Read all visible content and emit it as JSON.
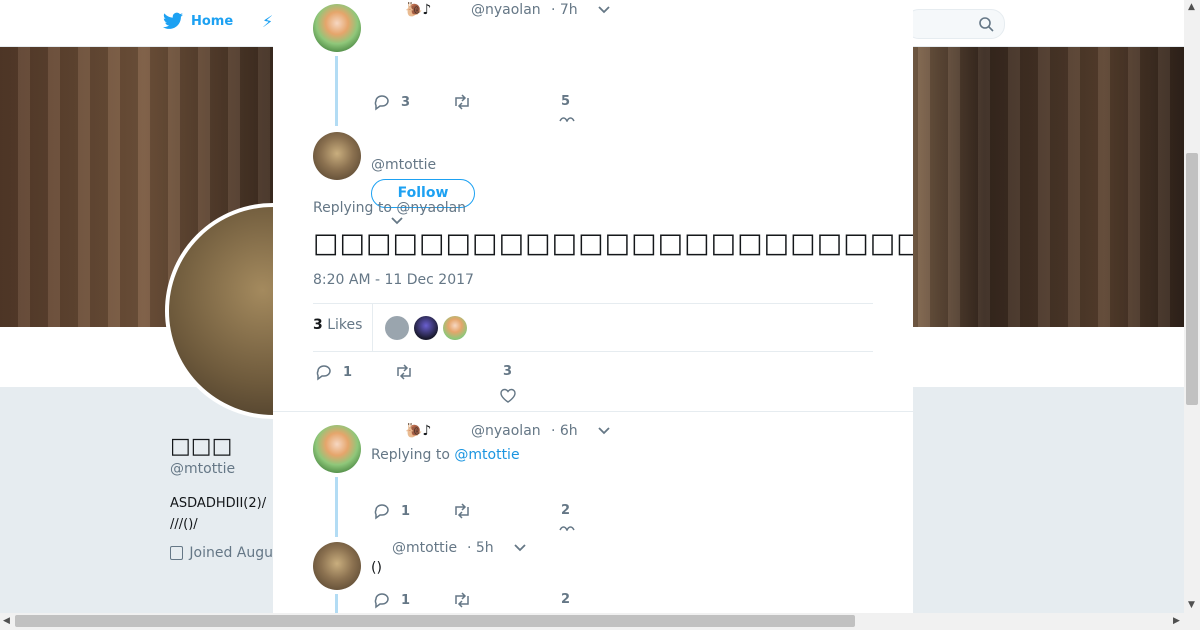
{
  "nav": {
    "home_label": "Home"
  },
  "profile": {
    "name": "□□□",
    "handle": "@mtottie",
    "bio_line1": "ASDADHDII(2)/",
    "bio_line2": "///()/",
    "joined": "Joined Augu"
  },
  "tweets": [
    {
      "display_name": "🐌♪",
      "handle": "@nyaolan",
      "time": "· 7h",
      "replies": "3",
      "likes": "5"
    }
  ],
  "main_tweet": {
    "handle": "@mtottie",
    "follow_label": "Follow",
    "replying_to_prefix": "Replying to ",
    "replying_to_handle": "@nyaolan",
    "text": "□□□□□□□□□□□□□□□□□□□□□□□□□□□□□□□□□□□□□□",
    "timestamp": "8:20 AM - 11 Dec 2017",
    "likes_count": "3",
    "likes_label": " Likes",
    "replies": "1",
    "likes": "3"
  },
  "reply1": {
    "display_name": "🐌♪",
    "handle": "@nyaolan",
    "time": "· 6h",
    "replying_to_prefix": "Replying to ",
    "replying_to_handle": "@mtottie",
    "replies": "1",
    "likes": "2"
  },
  "reply2": {
    "handle": "@mtottie",
    "time": "· 5h",
    "text": "()",
    "replies": "1",
    "likes": "2"
  },
  "colors": {
    "accent": "#1da1f2",
    "thread_line": "#b3dcf4",
    "muted": "#657786"
  }
}
